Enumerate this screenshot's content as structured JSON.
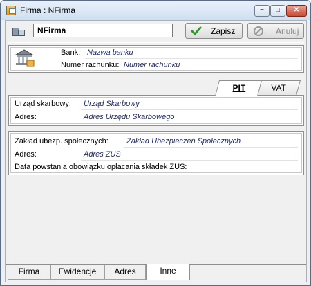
{
  "window": {
    "title": "Firma : NFirma",
    "controls": {
      "minimize": "−",
      "maximize": "□",
      "close": "✕"
    }
  },
  "toolbar": {
    "name_value": "NFirma",
    "save_label": "Zapisz",
    "cancel_label": "Anuluj"
  },
  "bank": {
    "bank_label": "Bank:",
    "bank_value": "Nazwa banku",
    "account_label": "Numer rachunku:",
    "account_value": "Numer rachunku"
  },
  "tax_tabs": [
    {
      "label": "PIT",
      "active": true
    },
    {
      "label": "VAT",
      "active": false
    }
  ],
  "pit": {
    "office_label": "Urząd skarbowy:",
    "office_value": "Urząd Skarbowy",
    "address_label": "Adres:",
    "address_value": "Adres Urzędu Skarbowego"
  },
  "zus": {
    "insurer_label": "Zakład ubezp. społecznych:",
    "insurer_value": "Zakład Ubezpieczeń Społecznych",
    "address_label": "Adres:",
    "address_value": "Adres ZUS",
    "date_label": "Data powstania obowiązku opłacania składek ZUS:"
  },
  "bottom_tabs": [
    {
      "label": "Firma",
      "active": false
    },
    {
      "label": "Ewidencje",
      "active": false
    },
    {
      "label": "Adres",
      "active": false
    },
    {
      "label": "Inne",
      "active": true
    }
  ],
  "colors": {
    "value_text": "#1f2a6e",
    "save_check": "#2e9a2e",
    "disabled_text": "#8a8a8a"
  }
}
